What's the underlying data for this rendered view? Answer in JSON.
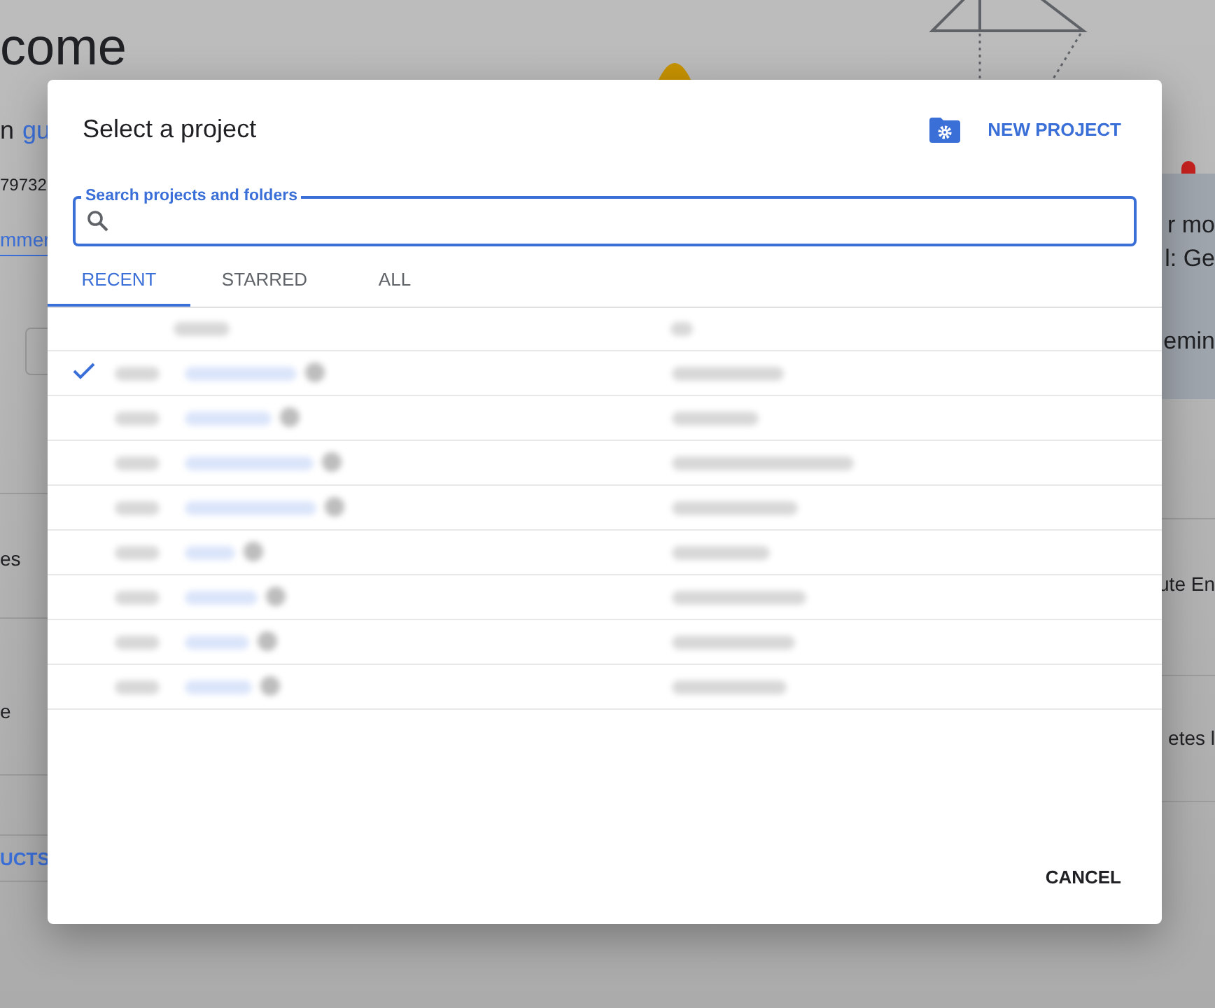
{
  "background": {
    "heading": "come",
    "intro_prefix": "n",
    "intro_link": "gu",
    "id_fragment": "79732",
    "link_fragment": "mmer",
    "left_items": [
      "es",
      "e"
    ],
    "products_button": "UCTS",
    "card_lines": [
      "r mo",
      "l: Ge",
      "emin"
    ],
    "right_items": [
      "ute En",
      "etes l"
    ]
  },
  "dialog": {
    "title": "Select a project",
    "new_project_button": "NEW PROJECT",
    "search": {
      "label": "Search projects and folders"
    },
    "tabs": [
      {
        "label": "RECENT",
        "selected": true
      },
      {
        "label": "STARRED",
        "selected": false
      },
      {
        "label": "ALL",
        "selected": false
      }
    ],
    "rows": [
      {
        "selected": true
      },
      {
        "selected": false
      },
      {
        "selected": false
      },
      {
        "selected": false
      },
      {
        "selected": false
      },
      {
        "selected": false
      },
      {
        "selected": false
      },
      {
        "selected": false
      }
    ],
    "cancel_button": "CANCEL"
  }
}
